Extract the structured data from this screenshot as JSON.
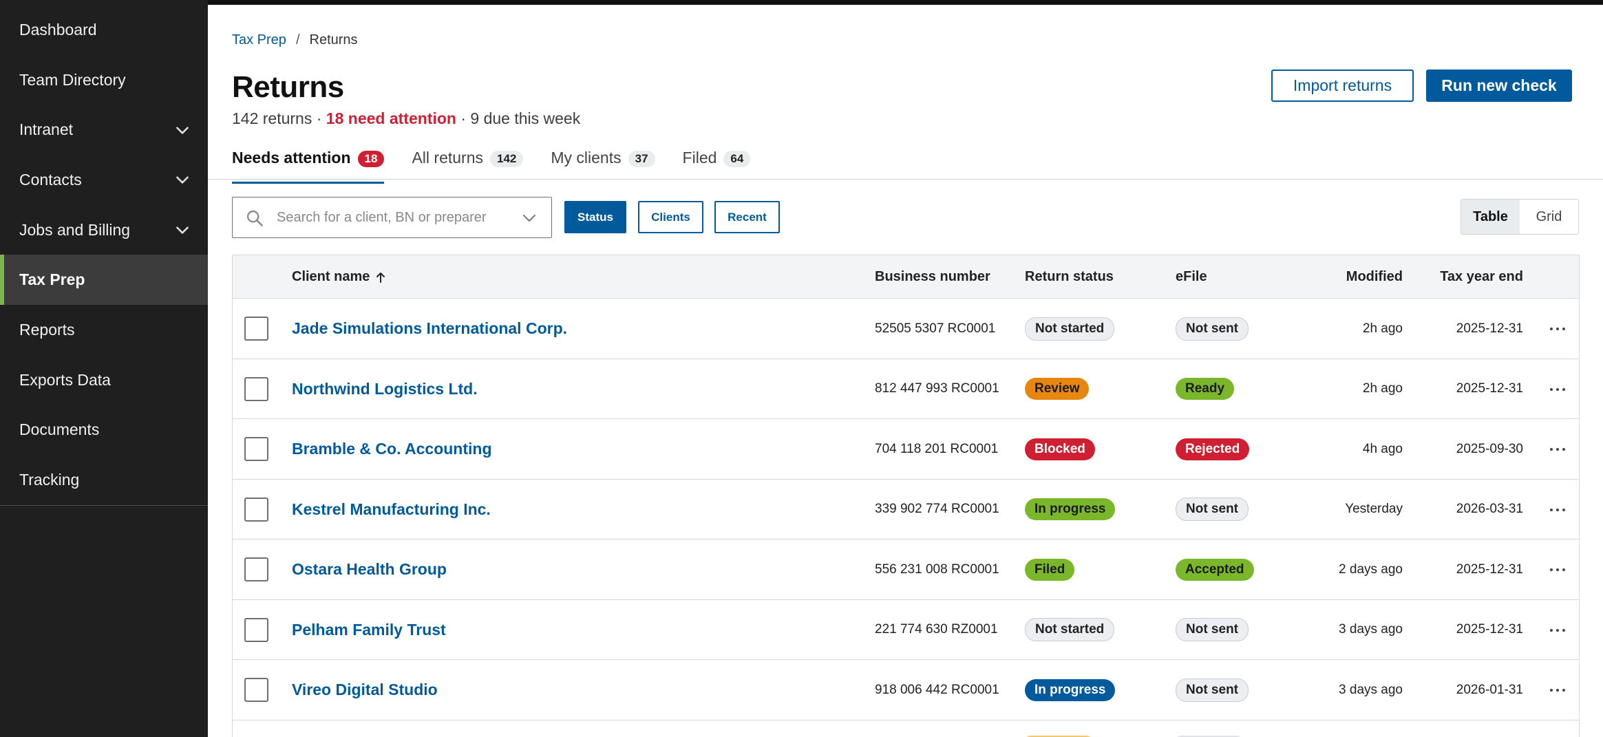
{
  "sidebar": {
    "items": [
      {
        "label": "Dashboard",
        "icon": ""
      },
      {
        "label": "Team Directory",
        "icon": ""
      },
      {
        "label": "Intranet",
        "icon": "chevron-down-icon"
      },
      {
        "label": "Contacts",
        "icon": "chevron-down-icon"
      },
      {
        "label": "Jobs and Billing",
        "icon": "chevron-down-icon"
      },
      {
        "label": "Tax Prep",
        "icon": "",
        "active": true
      },
      {
        "label": "Reports",
        "icon": ""
      },
      {
        "label": "Exports Data",
        "icon": ""
      },
      {
        "label": "Documents",
        "icon": ""
      },
      {
        "label": "Tracking",
        "icon": ""
      }
    ]
  },
  "breadcrumb": {
    "parent": "Tax Prep",
    "separator": "/",
    "current": "Returns"
  },
  "header": {
    "title": "Returns",
    "summary_total": "142 returns ·",
    "summary_attention": "18 need attention",
    "summary_due": "· 9 due this week",
    "import_label": "Import returns",
    "run_label": "Run new check"
  },
  "tabs": [
    {
      "label": "Needs attention",
      "count": "18",
      "active": true
    },
    {
      "label": "All returns",
      "count": "142"
    },
    {
      "label": "My clients",
      "count": "37"
    },
    {
      "label": "Filed",
      "count": "64"
    }
  ],
  "toolbar": {
    "search_placeholder": "Search for a client, BN or preparer",
    "search_value": "",
    "filters": [
      {
        "label": "Status",
        "active": true
      },
      {
        "label": "Clients"
      },
      {
        "label": "Recent"
      }
    ],
    "view": {
      "table": "Table",
      "grid": "Grid",
      "selected": "Table"
    }
  },
  "table": {
    "columns": {
      "client": "Client name",
      "bn": "Business number",
      "status": "Return status",
      "efile": "eFile",
      "modified": "Modified",
      "year_end": "Tax year end"
    },
    "rows": [
      {
        "client": "Jade Simulations International Corp.",
        "bn": "52505 5307 RC0001",
        "status": "Not started",
        "status_tone": "neutral",
        "efile": "Not sent",
        "efile_tone": "neutral",
        "modified": "2h ago",
        "year_end": "2025-12-31"
      },
      {
        "client": "Northwind Logistics Ltd.",
        "bn": "812 447 993 RC0001",
        "status": "Review",
        "status_tone": "orange",
        "efile": "Ready",
        "efile_tone": "green",
        "modified": "2h ago",
        "year_end": "2025-12-31"
      },
      {
        "client": "Bramble & Co. Accounting",
        "bn": "704 118 201 RC0001",
        "status": "Blocked",
        "status_tone": "red",
        "efile": "Rejected",
        "efile_tone": "red",
        "modified": "4h ago",
        "year_end": "2025-09-30"
      },
      {
        "client": "Kestrel Manufacturing Inc.",
        "bn": "339 902 774 RC0001",
        "status": "In progress",
        "status_tone": "green",
        "efile": "Not sent",
        "efile_tone": "neutral",
        "modified": "Yesterday",
        "year_end": "2026-03-31"
      },
      {
        "client": "Ostara Health Group",
        "bn": "556 231 008 RC0001",
        "status": "Filed",
        "status_tone": "green",
        "efile": "Accepted",
        "efile_tone": "green",
        "modified": "2 days ago",
        "year_end": "2025-12-31"
      },
      {
        "client": "Pelham Family Trust",
        "bn": "221 774 630 RZ0001",
        "status": "Not started",
        "status_tone": "neutral",
        "efile": "Not sent",
        "efile_tone": "neutral",
        "modified": "3 days ago",
        "year_end": "2025-12-31"
      },
      {
        "client": "Vireo Digital Studio",
        "bn": "918 006 442 RC0001",
        "status": "In progress",
        "status_tone": "blue",
        "efile": "Not sent",
        "efile_tone": "neutral",
        "modified": "3 days ago",
        "year_end": "2026-01-31"
      }
    ]
  },
  "colors": {
    "accent": "#005a9c",
    "attention": "#d01f32",
    "active_marker": "#7ab648",
    "sidebar_bg": "#1f1f1f"
  }
}
